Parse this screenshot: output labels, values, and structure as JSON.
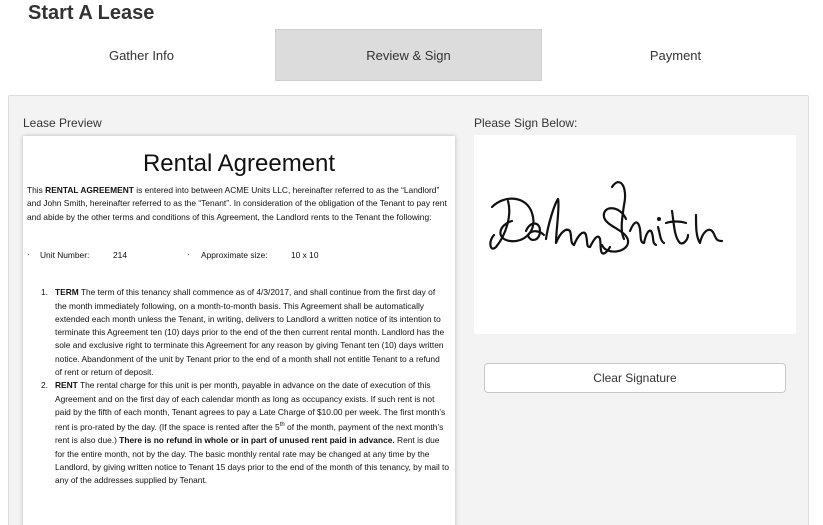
{
  "header": {
    "title": "Start A Lease"
  },
  "tabs": [
    {
      "label": "Gather Info"
    },
    {
      "label": "Review & Sign"
    },
    {
      "label": "Payment"
    }
  ],
  "preview": {
    "label": "Lease Preview"
  },
  "signature": {
    "label": "Please Sign Below:",
    "clear_label": "Clear Signature",
    "signature_text": "John Smith"
  },
  "document": {
    "title": "Rental Agreement",
    "intro_pre": "This ",
    "intro_bold": "RENTAL AGREEMENT",
    "intro_post": " is entered into between ACME Units LLC, hereinafter referred to as the “Landlord” and John Smith, hereinafter referred to as the “Tenant”.  In consideration of the obligation of the Tenant to pay rent and abide by the other terms and conditions of this Agreement, the Landlord rents to the Tenant the following:",
    "unit_number_label": "Unit Number:",
    "unit_number_value": "214",
    "size_label": "Approximate size:",
    "size_value": "10 x 10",
    "bullet": "·",
    "terms": [
      {
        "num": "1.",
        "heading": "TERM",
        "text": " The term of this tenancy shall commence as of 4/3/2017, and shall continue from the first day of the month immediately following, on a month-to-month basis.  This Agreement shall be automatically extended each month unless the Tenant, in writing, delivers to Landlord a written notice of its intention to terminate this Agreement ten (10) days prior to the end of the then current rental month.  Landlord has the sole and exclusive right to terminate this Agreement for any reason by giving Tenant ten (10) days written notice.  Abandonment of the unit by Tenant prior to the end of a month shall not entitle Tenant to a refund of rent or return of deposit."
      },
      {
        "num": "2.",
        "heading": "RENT",
        "text_a": " The rental charge for this unit is per month, payable in advance on the date of execution of this Agreement and on the first day of each calendar month as long as occupancy exists.  If such rent is not paid by the fifth of each month, Tenant agrees to pay a Late Charge of $10.00 per week.  The first month’s rent is pro-rated by the day.  (If the space is rented after the 5",
        "sup": "th",
        "text_b": " of the month, payment of the next month’s rent is also due.) ",
        "bold": "There is no refund in whole or in part of unused rent paid in advance.",
        "text_c": "  Rent is due for the entire month, not by the day.  The basic monthly rental rate may be changed at any time by the Landlord, by giving written notice to Tenant 15 days prior to the end of the month of this tenancy, by mail to any of the addresses supplied by Tenant."
      }
    ]
  }
}
